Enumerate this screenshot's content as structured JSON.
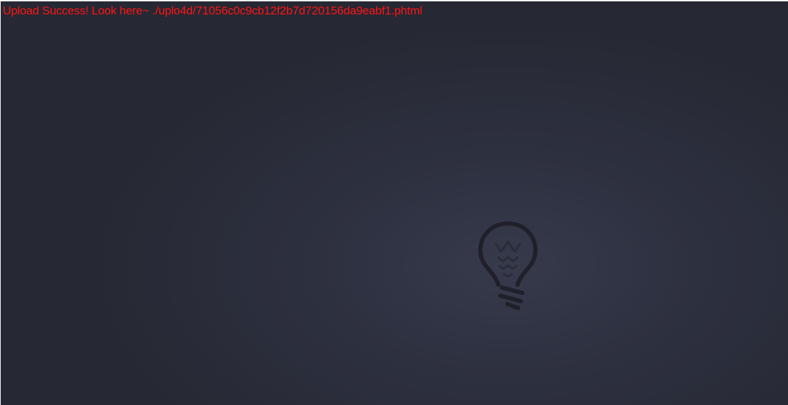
{
  "page": {
    "background_colors": [
      "#363a4b",
      "#2d303f",
      "#262833"
    ],
    "message": {
      "text": "Upload Success! Look here~ ./uplo4d/71056c0c9cb12f2b7d720156da9eabf1.phtml",
      "color": "#ff1414"
    },
    "decoration": {
      "icon": "lightbulb-icon",
      "color": "#1f2029"
    }
  }
}
